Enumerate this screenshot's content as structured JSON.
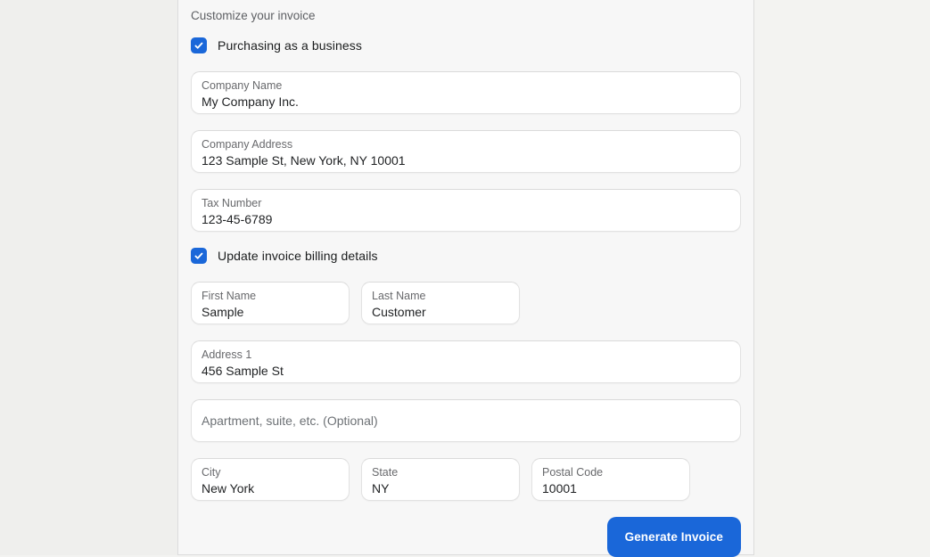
{
  "page": {
    "section_title": "Customize your invoice"
  },
  "colors": {
    "accent": "#1a67d9",
    "panel_bg": "#f7f7f7",
    "outer_bg": "#efefed",
    "field_bg": "#ffffff",
    "label_gray": "#68696c",
    "value_text": "#1f2123"
  },
  "business": {
    "checkbox_label": "Purchasing as a business",
    "checked": true,
    "fields": [
      {
        "label": "Company Name",
        "value": "My Company Inc."
      },
      {
        "label": "Company Address",
        "value": "123 Sample St, New York, NY 10001"
      },
      {
        "label": "Tax Number",
        "value": "123-45-6789"
      }
    ]
  },
  "billing": {
    "checkbox_label": "Update invoice billing details",
    "checked": true,
    "first_name": {
      "label": "First Name",
      "value": "Sample"
    },
    "last_name": {
      "label": "Last Name",
      "value": "Customer"
    },
    "address1": {
      "label": "Address 1",
      "value": "456 Sample St"
    },
    "address2": {
      "placeholder": "Apartment, suite, etc. (Optional)"
    },
    "city": {
      "label": "City",
      "value": "New York"
    },
    "state": {
      "label": "State",
      "value": "NY"
    },
    "postal_code": {
      "label": "Postal Code",
      "value": "10001"
    }
  },
  "actions": {
    "generate_invoice_label": "Generate Invoice"
  }
}
